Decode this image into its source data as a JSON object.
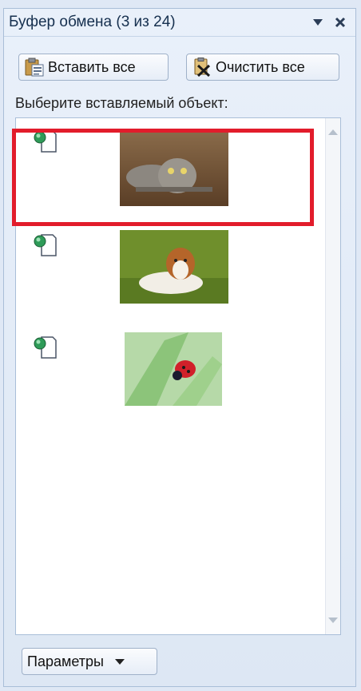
{
  "pane": {
    "title": "Буфер обмена (3 из 24)",
    "dropdown_icon": "triangle-down-icon",
    "close_icon": "close-icon"
  },
  "toolbar": {
    "paste_all_label": "Вставить все",
    "clear_all_label": "Очистить все"
  },
  "hint": "Выберите вставляемый объект:",
  "items": [
    {
      "type": "image",
      "content": "cat-photo",
      "selected": true
    },
    {
      "type": "image",
      "content": "dog-photo",
      "selected": false
    },
    {
      "type": "image",
      "content": "ladybug-photo",
      "selected": false
    }
  ],
  "footer": {
    "options_label": "Параметры"
  },
  "colors": {
    "selection": "#e21c2b",
    "pane_bg": "#dfe8f5",
    "list_bg": "#ffffff"
  }
}
